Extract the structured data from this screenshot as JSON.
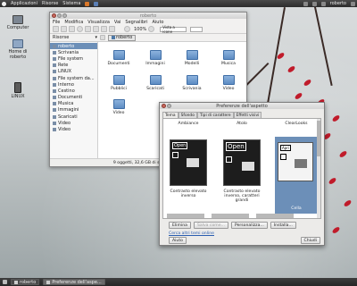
{
  "top_panel": {
    "menus": [
      "Applicazioni",
      "Risorse",
      "Sistema"
    ],
    "user": "roberto"
  },
  "desktop_icons": [
    {
      "label": "Computer"
    },
    {
      "label": "Home di roberto"
    },
    {
      "label": "LINUX"
    }
  ],
  "file_manager": {
    "title": "roberto",
    "menu": [
      "File",
      "Modifica",
      "Visualizza",
      "Vai",
      "Segnalibri",
      "Aiuto"
    ],
    "zoom": "100%",
    "view_mode": "Vista a icone",
    "sidebar_header": "Risorse",
    "location": "roberto",
    "sidebar_items": [
      "roberto",
      "Scrivania",
      "File system",
      "Rete",
      "LINUX",
      "File system da...",
      "Interno",
      "Cestino",
      "Documenti",
      "Musica",
      "Immagini",
      "Scaricati",
      "Video",
      "Video"
    ],
    "items": [
      "Documenti",
      "Immagini",
      "Modelli",
      "Musica",
      "Pubblici",
      "Scaricati",
      "Scrivania",
      "Video",
      "Video"
    ],
    "status": "9 oggetti, 32,6 GB di spazio libero"
  },
  "appearance": {
    "title": "Preferenze dell'aspetto",
    "tabs": [
      "Tema",
      "Sfondo",
      "Tipi di carattere",
      "Effetti visivi"
    ],
    "themes": [
      {
        "name": "Ambiance",
        "caption": "Contrasto elevato inverso",
        "preview_button": "Open"
      },
      {
        "name": "Atolo",
        "caption": "Contrasto elevato inverso, caratteri grandi",
        "preview_button": "Open"
      },
      {
        "name": "ClearLooks",
        "caption": "Cella",
        "preview_button": "Apri"
      }
    ],
    "buttons": [
      "Elimina",
      "Salva come...",
      "Personalizza...",
      "Installa..."
    ],
    "link": "Cerca altri temi online",
    "help": "Aiuto",
    "close": "Chiudi"
  },
  "taskbar": {
    "user": "roberto",
    "items": [
      "Preferenze dell'aspe..."
    ]
  },
  "colors": {
    "accent_blue": "#6c8fb8",
    "leaf_red": "#c01b2a"
  }
}
